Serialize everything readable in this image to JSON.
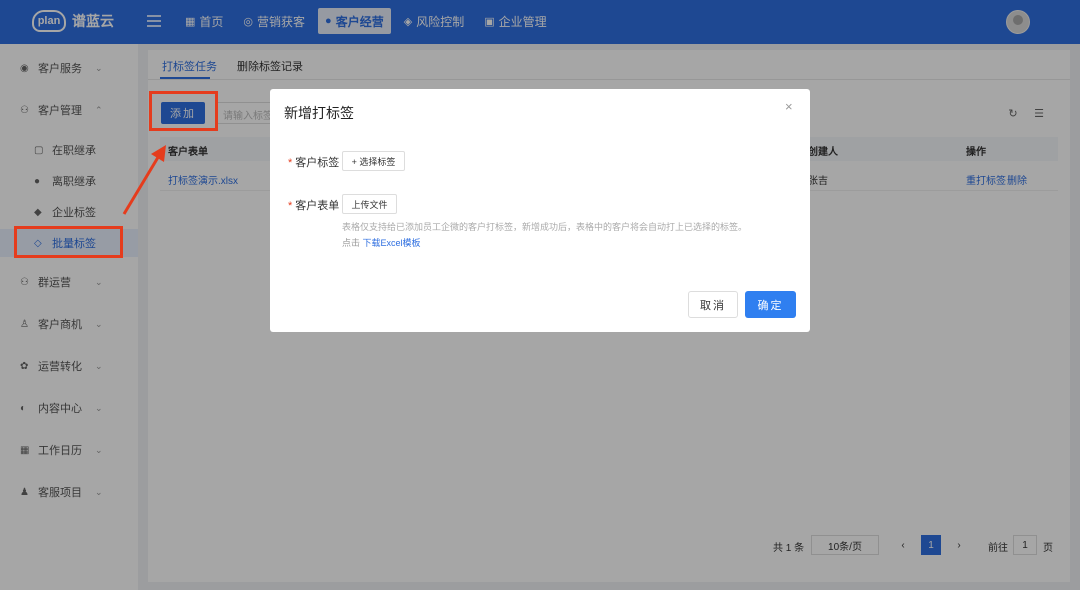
{
  "brand": {
    "logo_mark": "plan",
    "name": "谱蓝云"
  },
  "topnav": {
    "items": [
      {
        "icon": "grid-icon",
        "glyph": "▦",
        "label": "首页"
      },
      {
        "icon": "target-icon",
        "glyph": "◎",
        "label": "营销获客"
      },
      {
        "icon": "user-icon",
        "glyph": "●",
        "label": "客户经营"
      },
      {
        "icon": "shield-icon",
        "glyph": "◈",
        "label": "风险控制"
      },
      {
        "icon": "building-icon",
        "glyph": "▣",
        "label": "企业管理"
      }
    ],
    "active_index": 2
  },
  "sidebar": {
    "items": [
      {
        "icon": "github-icon",
        "glyph": "◉",
        "label": "客户服务",
        "chev": "⌄"
      },
      {
        "icon": "users-icon",
        "glyph": "⚇",
        "label": "客户管理",
        "chev": "⌃"
      },
      {
        "icon": "folder-icon",
        "glyph": "▢",
        "label": "在职继承"
      },
      {
        "icon": "person-icon",
        "glyph": "●",
        "label": "离职继承"
      },
      {
        "icon": "tag-icon",
        "glyph": "◆",
        "label": "企业标签"
      },
      {
        "icon": "tag-outline-icon",
        "glyph": "◇",
        "label": "批量标签"
      },
      {
        "icon": "group-icon",
        "glyph": "⚇",
        "label": "群运营",
        "chev": "⌄"
      },
      {
        "icon": "user-outline-icon",
        "glyph": "♙",
        "label": "客户商机",
        "chev": "⌄"
      },
      {
        "icon": "aperture-icon",
        "glyph": "✿",
        "label": "运营转化",
        "chev": "⌄"
      },
      {
        "icon": "globe-icon",
        "glyph": "◐",
        "label": "内容中心",
        "chev": "⌄"
      },
      {
        "icon": "calendar-icon",
        "glyph": "▦",
        "label": "工作日历",
        "chev": "⌄"
      },
      {
        "icon": "team-icon",
        "glyph": "♟",
        "label": "客服项目",
        "chev": "⌄"
      }
    ]
  },
  "content": {
    "tabs": [
      "打标签任务",
      "删除标签记录"
    ],
    "add_label": "添加",
    "search_placeholder": "请输入标签名称",
    "refresh_glyph": "↻",
    "settings_glyph": "☰",
    "table": {
      "headers": [
        "客户表单",
        "创建人",
        "操作"
      ],
      "rows": [
        {
          "file": "打标签演示.xlsx",
          "creator": "张吉",
          "actions": [
            "重打标签",
            "删除"
          ]
        }
      ]
    },
    "pager": {
      "total": "共 1 条",
      "page_size": "10条/页",
      "prev": "‹",
      "current": "1",
      "next": "›",
      "goto_label": "前往",
      "goto_value": "1",
      "page_unit": "页"
    }
  },
  "modal": {
    "title": "新增打标签",
    "close_glyph": "×",
    "required_mark": "*",
    "tag_label": "客户标签",
    "tag_button": "+ 选择标签",
    "form_label": "客户表单",
    "upload_button": "上传文件",
    "hint": "表格仅支持给已添加员工企微的客户打标签，新增成功后，表格中的客户将会自动打上已选择的标签。",
    "download_prefix": "点击",
    "download_link": "下载Excel模板",
    "cancel": "取消",
    "confirm": "确定"
  },
  "colors": {
    "primary": "#2f6fe0",
    "annotation_red": "#e53c1d",
    "required_red": "#e53c1d"
  }
}
